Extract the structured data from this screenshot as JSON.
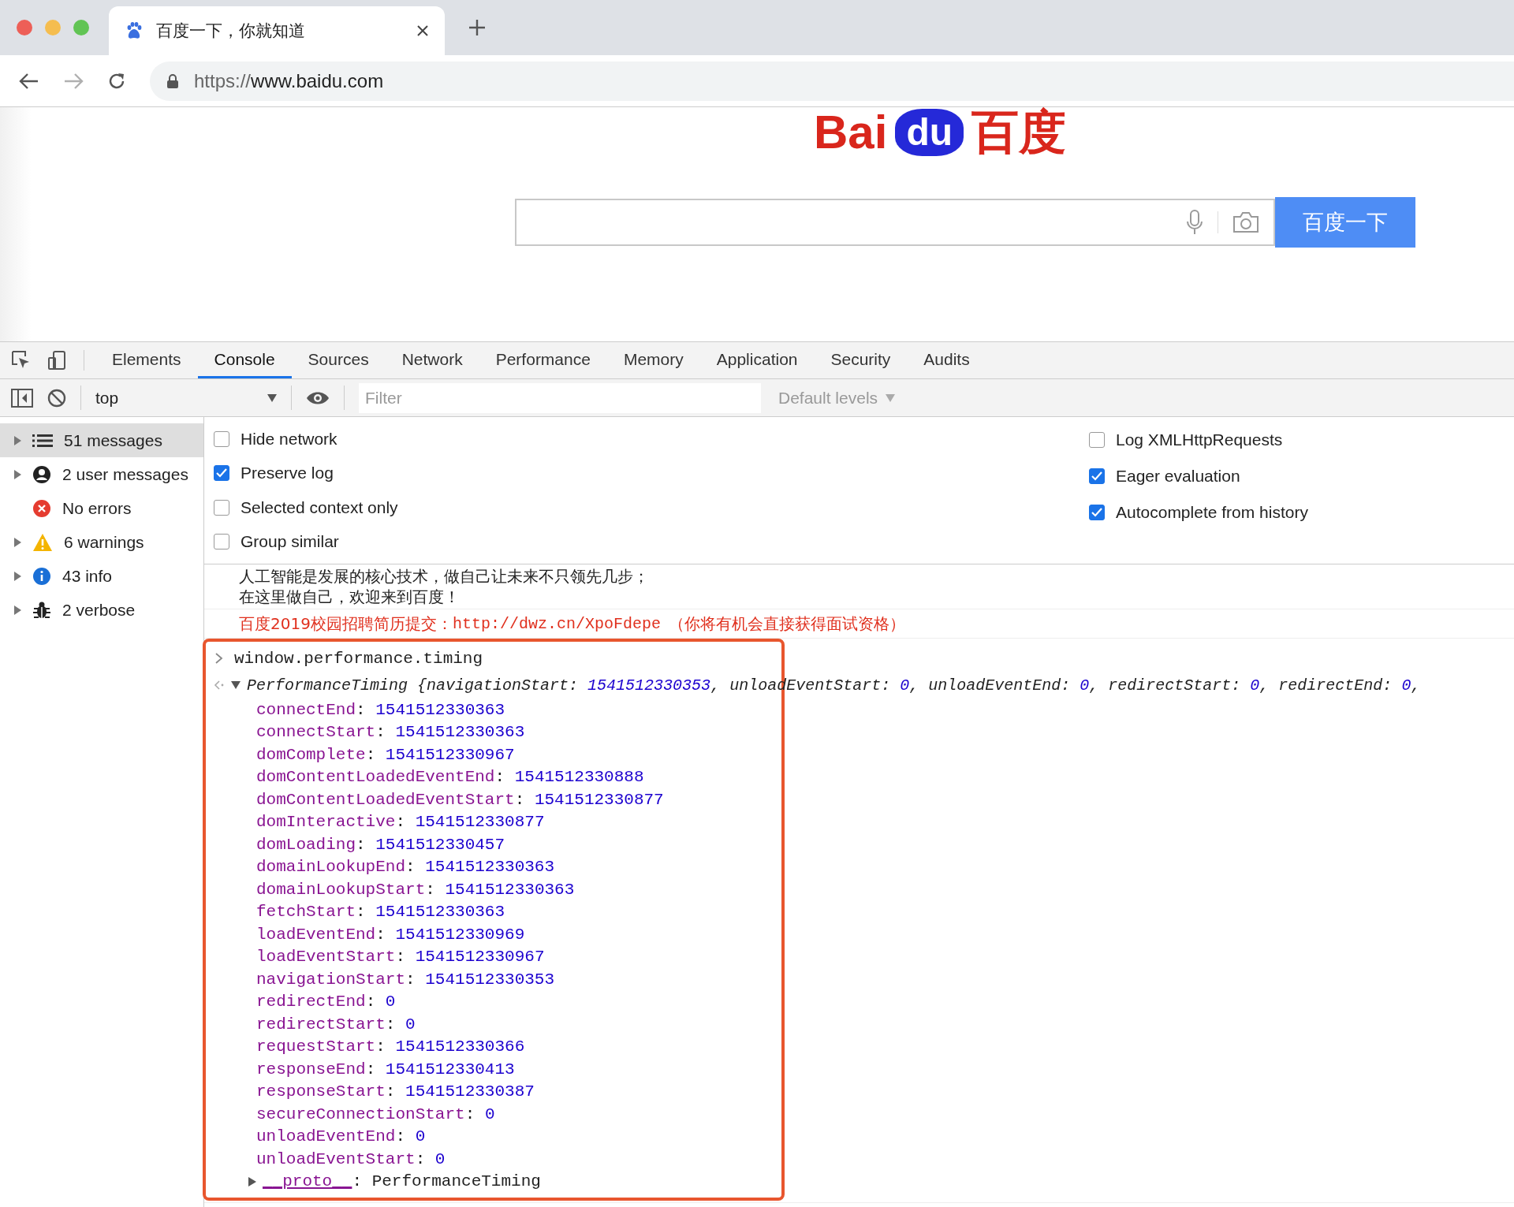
{
  "browser": {
    "tab": {
      "title": "百度一下，你就知道"
    },
    "address": {
      "scheme": "https://",
      "host": "www.baidu.com"
    }
  },
  "page": {
    "logo": {
      "left": "Bai",
      "badge": "du",
      "right": "百度"
    },
    "search": {
      "button": "百度一下"
    }
  },
  "devtools": {
    "tabs": [
      {
        "label": "Elements",
        "selected": false
      },
      {
        "label": "Console",
        "selected": true
      },
      {
        "label": "Sources",
        "selected": false
      },
      {
        "label": "Network",
        "selected": false
      },
      {
        "label": "Performance",
        "selected": false
      },
      {
        "label": "Memory",
        "selected": false
      },
      {
        "label": "Application",
        "selected": false
      },
      {
        "label": "Security",
        "selected": false
      },
      {
        "label": "Audits",
        "selected": false
      }
    ],
    "toolbar": {
      "context": "top",
      "filter_placeholder": "Filter",
      "levels": "Default levels"
    },
    "sidebar": [
      {
        "kind": "list",
        "label": "51 messages",
        "expandable": true,
        "selected": true
      },
      {
        "kind": "user",
        "label": "2 user messages",
        "expandable": true,
        "selected": false
      },
      {
        "kind": "error",
        "label": "No errors",
        "expandable": false,
        "selected": false
      },
      {
        "kind": "warning",
        "label": "6 warnings",
        "expandable": true,
        "selected": false
      },
      {
        "kind": "info",
        "label": "43 info",
        "expandable": true,
        "selected": false
      },
      {
        "kind": "verbose",
        "label": "2 verbose",
        "expandable": true,
        "selected": false
      }
    ],
    "settings_left": [
      {
        "label": "Hide network",
        "checked": false
      },
      {
        "label": "Preserve log",
        "checked": true
      },
      {
        "label": "Selected context only",
        "checked": false
      },
      {
        "label": "Group similar",
        "checked": false
      }
    ],
    "settings_right": [
      {
        "label": "Log XMLHttpRequests",
        "checked": false
      },
      {
        "label": "Eager evaluation",
        "checked": true
      },
      {
        "label": "Autocomplete from history",
        "checked": true
      }
    ],
    "console": {
      "log_lines": [
        "人工智能是发展的核心技术，做自己让未来不只领先几步；",
        "在这里做自己，欢迎来到百度！"
      ],
      "notice": {
        "prefix": "百度2019校园招聘简历提交：",
        "link": "http://dwz.cn/XpoFdepe",
        "suffix": "（你将有机会直接获得面试资格）"
      },
      "input": "window.performance.timing",
      "result": {
        "expanded": true,
        "class_name": "PerformanceTiming",
        "open": "{",
        "separator": ": ",
        "comma": ",",
        "preview": [
          {
            "key": "navigationStart",
            "value": "1541512330353"
          },
          {
            "key": "unloadEventStart",
            "value": "0"
          },
          {
            "key": "unloadEventEnd",
            "value": "0"
          },
          {
            "key": "redirectStart",
            "value": "0"
          },
          {
            "key": "redirectEnd",
            "value": "0"
          }
        ],
        "properties": [
          {
            "key": "connectEnd",
            "value": "1541512330363"
          },
          {
            "key": "connectStart",
            "value": "1541512330363"
          },
          {
            "key": "domComplete",
            "value": "1541512330967"
          },
          {
            "key": "domContentLoadedEventEnd",
            "value": "1541512330888"
          },
          {
            "key": "domContentLoadedEventStart",
            "value": "1541512330877"
          },
          {
            "key": "domInteractive",
            "value": "1541512330877"
          },
          {
            "key": "domLoading",
            "value": "1541512330457"
          },
          {
            "key": "domainLookupEnd",
            "value": "1541512330363"
          },
          {
            "key": "domainLookupStart",
            "value": "1541512330363"
          },
          {
            "key": "fetchStart",
            "value": "1541512330363"
          },
          {
            "key": "loadEventEnd",
            "value": "1541512330969"
          },
          {
            "key": "loadEventStart",
            "value": "1541512330967"
          },
          {
            "key": "navigationStart",
            "value": "1541512330353"
          },
          {
            "key": "redirectEnd",
            "value": "0"
          },
          {
            "key": "redirectStart",
            "value": "0"
          },
          {
            "key": "requestStart",
            "value": "1541512330366"
          },
          {
            "key": "responseEnd",
            "value": "1541512330413"
          },
          {
            "key": "responseStart",
            "value": "1541512330387"
          },
          {
            "key": "secureConnectionStart",
            "value": "0"
          },
          {
            "key": "unloadEventEnd",
            "value": "0"
          },
          {
            "key": "unloadEventStart",
            "value": "0"
          }
        ],
        "proto": {
          "expanded": false,
          "key": "__proto__",
          "value": "PerformanceTiming"
        }
      }
    }
  }
}
